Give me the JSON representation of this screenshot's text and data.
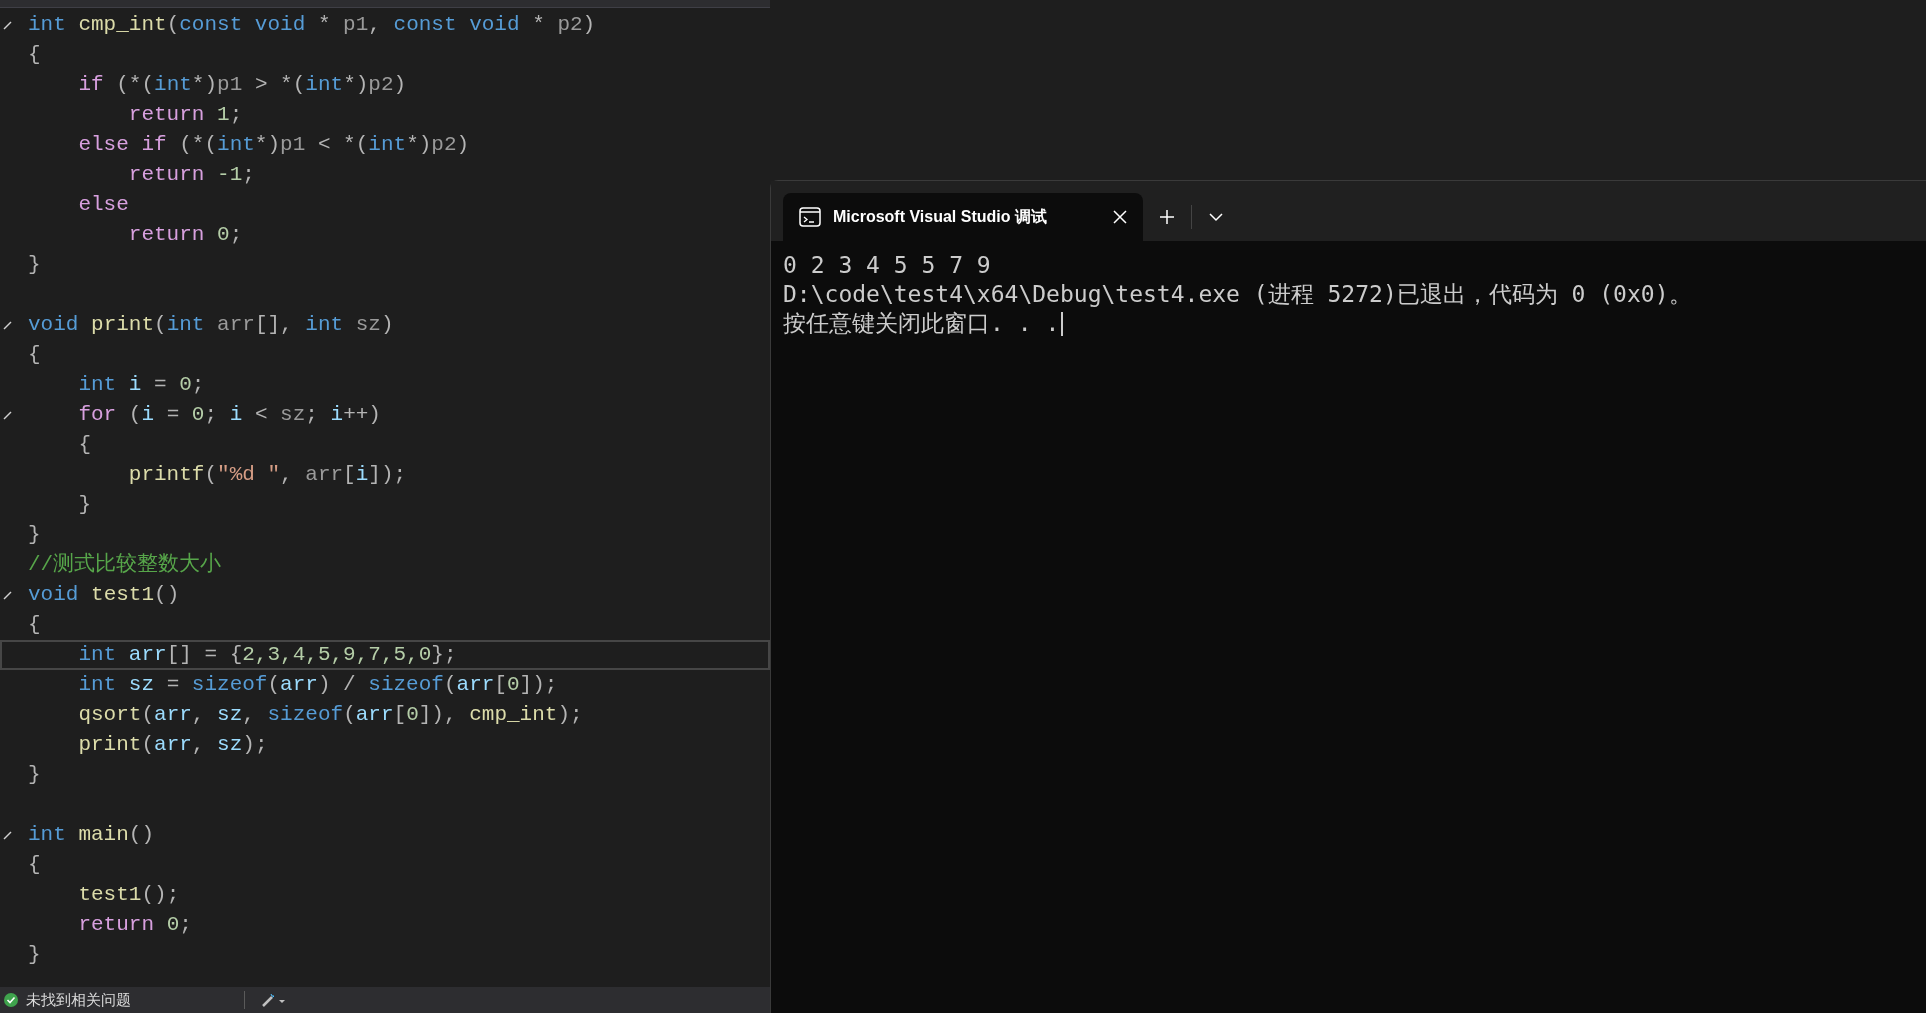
{
  "editor": {
    "lines": [
      {
        "fold": true,
        "current": false,
        "tokens": [
          {
            "kind": "kw",
            "text": "int"
          },
          {
            "kind": "fn",
            "text": " cmp_int"
          },
          {
            "kind": "pl",
            "text": "("
          },
          {
            "kind": "kw",
            "text": "const void"
          },
          {
            "kind": "pl",
            "text": " * "
          },
          {
            "kind": "pa",
            "text": "p1"
          },
          {
            "kind": "pl",
            "text": ", "
          },
          {
            "kind": "kw",
            "text": "const void"
          },
          {
            "kind": "pl",
            "text": " * "
          },
          {
            "kind": "pa",
            "text": "p2"
          },
          {
            "kind": "pl",
            "text": ")"
          }
        ]
      },
      {
        "fold": false,
        "current": false,
        "tokens": [
          {
            "kind": "pl",
            "text": "{"
          }
        ]
      },
      {
        "fold": false,
        "current": false,
        "tokens": [
          {
            "kind": "ct",
            "text": "    if"
          },
          {
            "kind": "pl",
            "text": " (*("
          },
          {
            "kind": "kw",
            "text": "int"
          },
          {
            "kind": "pl",
            "text": "*)"
          },
          {
            "kind": "pa",
            "text": "p1"
          },
          {
            "kind": "pl",
            "text": " > *("
          },
          {
            "kind": "kw",
            "text": "int"
          },
          {
            "kind": "pl",
            "text": "*)"
          },
          {
            "kind": "pa",
            "text": "p2"
          },
          {
            "kind": "pl",
            "text": ")"
          }
        ]
      },
      {
        "fold": false,
        "current": false,
        "tokens": [
          {
            "kind": "ct",
            "text": "        return"
          },
          {
            "kind": "nu",
            "text": " 1"
          },
          {
            "kind": "pl",
            "text": ";"
          }
        ]
      },
      {
        "fold": false,
        "current": false,
        "tokens": [
          {
            "kind": "ct",
            "text": "    else if"
          },
          {
            "kind": "pl",
            "text": " (*("
          },
          {
            "kind": "kw",
            "text": "int"
          },
          {
            "kind": "pl",
            "text": "*)"
          },
          {
            "kind": "pa",
            "text": "p1"
          },
          {
            "kind": "pl",
            "text": " < *("
          },
          {
            "kind": "kw",
            "text": "int"
          },
          {
            "kind": "pl",
            "text": "*)"
          },
          {
            "kind": "pa",
            "text": "p2"
          },
          {
            "kind": "pl",
            "text": ")"
          }
        ]
      },
      {
        "fold": false,
        "current": false,
        "tokens": [
          {
            "kind": "ct",
            "text": "        return"
          },
          {
            "kind": "nu",
            "text": " -1"
          },
          {
            "kind": "pl",
            "text": ";"
          }
        ]
      },
      {
        "fold": false,
        "current": false,
        "tokens": [
          {
            "kind": "ct",
            "text": "    else"
          }
        ]
      },
      {
        "fold": false,
        "current": false,
        "tokens": [
          {
            "kind": "ct",
            "text": "        return"
          },
          {
            "kind": "nu",
            "text": " 0"
          },
          {
            "kind": "pl",
            "text": ";"
          }
        ]
      },
      {
        "fold": false,
        "current": false,
        "tokens": [
          {
            "kind": "pl",
            "text": "}"
          }
        ]
      },
      {
        "fold": true,
        "current": false,
        "blank_line_before": true,
        "tokens": [
          {
            "kind": "kw",
            "text": "void"
          },
          {
            "kind": "fn",
            "text": " print"
          },
          {
            "kind": "pl",
            "text": "("
          },
          {
            "kind": "kw",
            "text": "int"
          },
          {
            "kind": "pa",
            "text": " arr"
          },
          {
            "kind": "pl",
            "text": "[], "
          },
          {
            "kind": "kw",
            "text": "int"
          },
          {
            "kind": "pa",
            "text": " sz"
          },
          {
            "kind": "pl",
            "text": ")"
          }
        ]
      },
      {
        "fold": false,
        "current": false,
        "tokens": [
          {
            "kind": "pl",
            "text": "{"
          }
        ]
      },
      {
        "fold": false,
        "current": false,
        "tokens": [
          {
            "kind": "kw",
            "text": "    int"
          },
          {
            "kind": "va",
            "text": " i"
          },
          {
            "kind": "pl",
            "text": " = "
          },
          {
            "kind": "nu",
            "text": "0"
          },
          {
            "kind": "pl",
            "text": ";"
          }
        ]
      },
      {
        "fold": true,
        "current": false,
        "tokens": [
          {
            "kind": "ct",
            "text": "    for"
          },
          {
            "kind": "pl",
            "text": " ("
          },
          {
            "kind": "va",
            "text": "i"
          },
          {
            "kind": "pl",
            "text": " = "
          },
          {
            "kind": "nu",
            "text": "0"
          },
          {
            "kind": "pl",
            "text": "; "
          },
          {
            "kind": "va",
            "text": "i"
          },
          {
            "kind": "pl",
            "text": " < "
          },
          {
            "kind": "pa",
            "text": "sz"
          },
          {
            "kind": "pl",
            "text": "; "
          },
          {
            "kind": "va",
            "text": "i"
          },
          {
            "kind": "pl",
            "text": "++)"
          }
        ]
      },
      {
        "fold": false,
        "current": false,
        "tokens": [
          {
            "kind": "pl",
            "text": "    {"
          }
        ]
      },
      {
        "fold": false,
        "current": false,
        "tokens": [
          {
            "kind": "fn",
            "text": "        printf"
          },
          {
            "kind": "pl",
            "text": "("
          },
          {
            "kind": "st",
            "text": "\"%d \""
          },
          {
            "kind": "pl",
            "text": ", "
          },
          {
            "kind": "pa",
            "text": "arr"
          },
          {
            "kind": "pl",
            "text": "["
          },
          {
            "kind": "va",
            "text": "i"
          },
          {
            "kind": "pl",
            "text": "]);"
          }
        ]
      },
      {
        "fold": false,
        "current": false,
        "tokens": [
          {
            "kind": "pl",
            "text": "    }"
          }
        ]
      },
      {
        "fold": false,
        "current": false,
        "tokens": [
          {
            "kind": "pl",
            "text": "}"
          }
        ]
      },
      {
        "fold": false,
        "current": false,
        "tokens": [
          {
            "kind": "cm",
            "text": "//测式比较整数大小"
          }
        ]
      },
      {
        "fold": true,
        "current": false,
        "tokens": [
          {
            "kind": "kw",
            "text": "void"
          },
          {
            "kind": "fn",
            "text": " test1"
          },
          {
            "kind": "pl",
            "text": "()"
          }
        ]
      },
      {
        "fold": false,
        "current": false,
        "tokens": [
          {
            "kind": "pl",
            "text": "{"
          }
        ]
      },
      {
        "fold": false,
        "current": true,
        "tokens": [
          {
            "kind": "kw",
            "text": "    int"
          },
          {
            "kind": "va",
            "text": " arr"
          },
          {
            "kind": "pl",
            "text": "[] = {"
          },
          {
            "kind": "nu",
            "text": "2,3,4,5,9,7,5,0"
          },
          {
            "kind": "pl",
            "text": "};"
          }
        ]
      },
      {
        "fold": false,
        "current": false,
        "tokens": [
          {
            "kind": "kw",
            "text": "    int"
          },
          {
            "kind": "va",
            "text": " sz"
          },
          {
            "kind": "pl",
            "text": " = "
          },
          {
            "kind": "kw",
            "text": "sizeof"
          },
          {
            "kind": "pl",
            "text": "("
          },
          {
            "kind": "va",
            "text": "arr"
          },
          {
            "kind": "pl",
            "text": ") / "
          },
          {
            "kind": "kw",
            "text": "sizeof"
          },
          {
            "kind": "pl",
            "text": "("
          },
          {
            "kind": "va",
            "text": "arr"
          },
          {
            "kind": "pl",
            "text": "["
          },
          {
            "kind": "nu",
            "text": "0"
          },
          {
            "kind": "pl",
            "text": "]);"
          }
        ]
      },
      {
        "fold": false,
        "current": false,
        "tokens": [
          {
            "kind": "fn",
            "text": "    qsort"
          },
          {
            "kind": "pl",
            "text": "("
          },
          {
            "kind": "va",
            "text": "arr"
          },
          {
            "kind": "pl",
            "text": ", "
          },
          {
            "kind": "va",
            "text": "sz"
          },
          {
            "kind": "pl",
            "text": ", "
          },
          {
            "kind": "kw",
            "text": "sizeof"
          },
          {
            "kind": "pl",
            "text": "("
          },
          {
            "kind": "va",
            "text": "arr"
          },
          {
            "kind": "pl",
            "text": "["
          },
          {
            "kind": "nu",
            "text": "0"
          },
          {
            "kind": "pl",
            "text": "]), "
          },
          {
            "kind": "fn",
            "text": "cmp_int"
          },
          {
            "kind": "pl",
            "text": ");"
          }
        ]
      },
      {
        "fold": false,
        "current": false,
        "tokens": [
          {
            "kind": "fn",
            "text": "    print"
          },
          {
            "kind": "pl",
            "text": "("
          },
          {
            "kind": "va",
            "text": "arr"
          },
          {
            "kind": "pl",
            "text": ", "
          },
          {
            "kind": "va",
            "text": "sz"
          },
          {
            "kind": "pl",
            "text": ");"
          }
        ]
      },
      {
        "fold": false,
        "current": false,
        "tokens": [
          {
            "kind": "pl",
            "text": "}"
          }
        ]
      },
      {
        "fold": true,
        "current": false,
        "blank_line_before": true,
        "tokens": [
          {
            "kind": "kw",
            "text": "int"
          },
          {
            "kind": "fn",
            "text": " main"
          },
          {
            "kind": "pl",
            "text": "()"
          }
        ]
      },
      {
        "fold": false,
        "current": false,
        "tokens": [
          {
            "kind": "pl",
            "text": "{"
          }
        ]
      },
      {
        "fold": false,
        "current": false,
        "tokens": [
          {
            "kind": "fn",
            "text": "    test1"
          },
          {
            "kind": "pl",
            "text": "();"
          }
        ]
      },
      {
        "fold": false,
        "current": false,
        "tokens": [
          {
            "kind": "ct",
            "text": "    return"
          },
          {
            "kind": "nu",
            "text": " 0"
          },
          {
            "kind": "pl",
            "text": ";"
          }
        ]
      },
      {
        "fold": false,
        "current": false,
        "tokens": [
          {
            "kind": "pl",
            "text": "}"
          }
        ]
      }
    ]
  },
  "status_bar": {
    "message": "未找到相关问题"
  },
  "console": {
    "tab": {
      "title": "Microsoft Visual Studio 调试"
    },
    "output": [
      "0 2 3 4 5 5 7 9",
      "D:\\code\\test4\\x64\\Debug\\test4.exe (进程 5272)已退出，代码为 0 (0x0)。",
      "按任意键关闭此窗口. . ."
    ]
  }
}
